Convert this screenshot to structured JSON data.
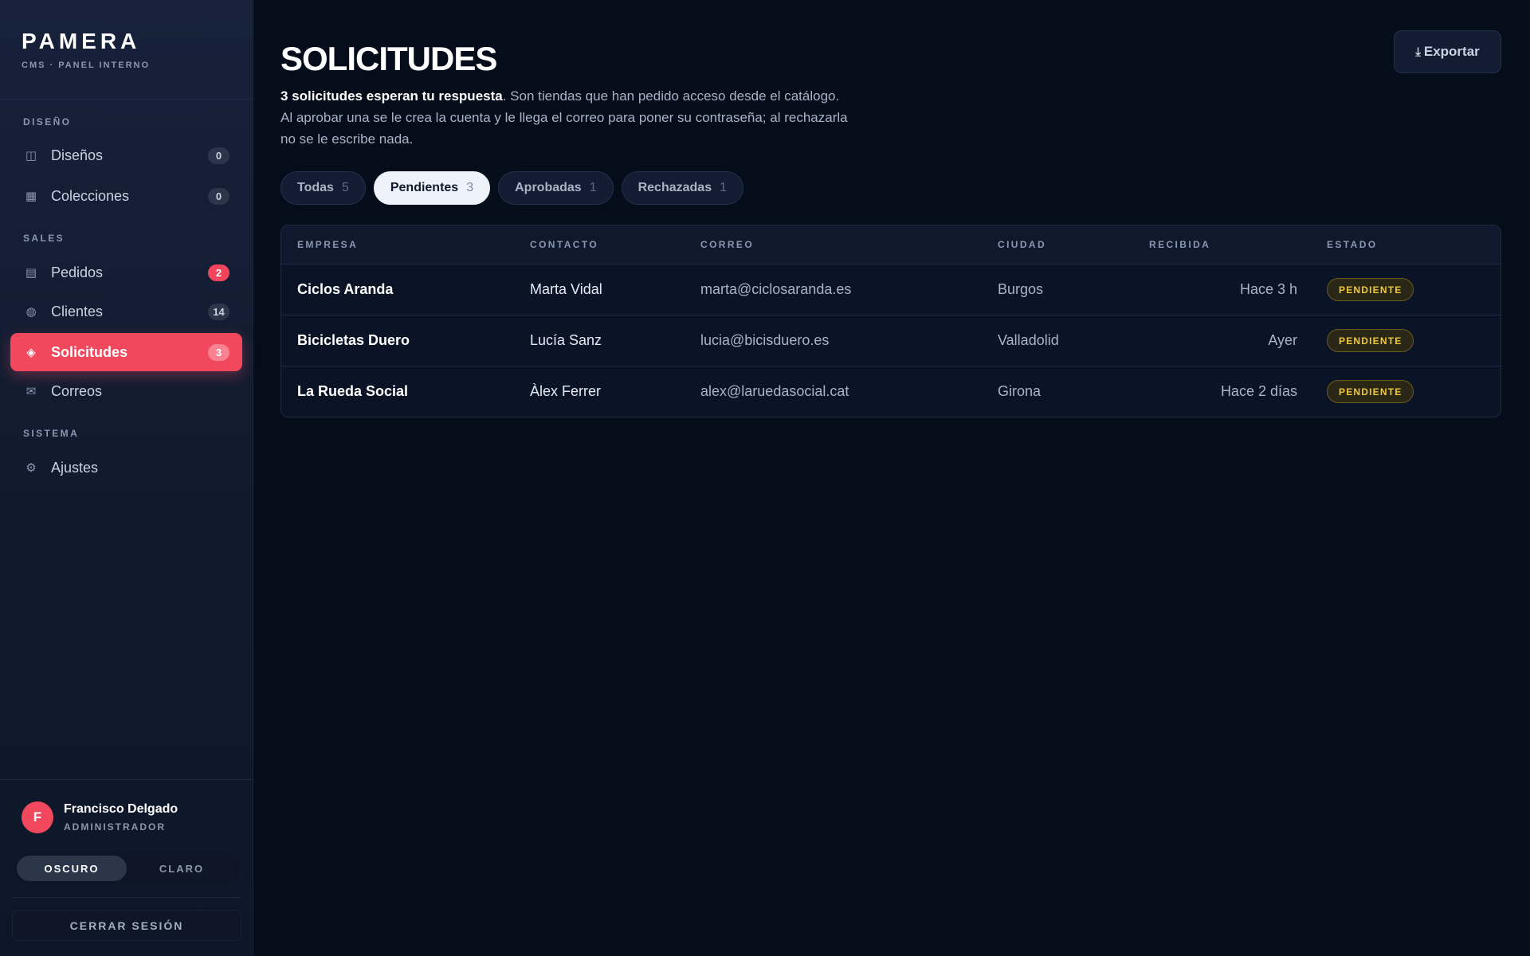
{
  "brand": {
    "name": "PAMERA",
    "subtitle": "CMS · PANEL INTERNO"
  },
  "sidebar": {
    "sections": [
      {
        "title": "DISEÑO",
        "items": [
          {
            "label": "Diseños",
            "icon": "layout-icon",
            "glyph": "◫",
            "badge": "0"
          },
          {
            "label": "Colecciones",
            "icon": "grid-icon",
            "glyph": "▦",
            "badge": "0"
          }
        ]
      },
      {
        "title": "SALES",
        "items": [
          {
            "label": "Pedidos",
            "icon": "receipt-icon",
            "glyph": "▤",
            "badge": "2"
          },
          {
            "label": "Clientes",
            "icon": "globe-icon",
            "glyph": "◍",
            "badge": "14"
          },
          {
            "label": "Solicitudes",
            "icon": "diamond-icon",
            "glyph": "◈",
            "badge": "3"
          },
          {
            "label": "Correos",
            "icon": "mail-icon",
            "glyph": "✉"
          }
        ]
      },
      {
        "title": "SISTEMA",
        "items": [
          {
            "label": "Ajustes",
            "icon": "gear-icon",
            "glyph": "⚙"
          }
        ]
      }
    ]
  },
  "user": {
    "initial": "F",
    "name": "Francisco Delgado",
    "role": "ADMINISTRADOR"
  },
  "theme": {
    "dark": "OSCURO",
    "light": "CLARO"
  },
  "logout_label": "CERRAR SESIÓN",
  "page": {
    "title": "SOLICITUDES",
    "intro_strong": "3 solicitudes esperan tu respuesta",
    "intro_rest": ". Son tiendas que han pedido acceso desde el catálogo. Al aprobar una se le crea la cuenta y le llega el correo para poner su contraseña; al rechazarla no se le escribe nada.",
    "export_label": "Exportar",
    "export_glyph": "⤓"
  },
  "tabs": [
    {
      "label": "Todas",
      "count": "5"
    },
    {
      "label": "Pendientes",
      "count": "3"
    },
    {
      "label": "Aprobadas",
      "count": "1"
    },
    {
      "label": "Rechazadas",
      "count": "1"
    }
  ],
  "table": {
    "headers": {
      "empresa": "EMPRESA",
      "contacto": "CONTACTO",
      "correo": "CORREO",
      "ciudad": "CIUDAD",
      "recibida": "RECIBIDA",
      "estado": "ESTADO"
    },
    "rows": [
      {
        "empresa": "Ciclos Aranda",
        "contacto": "Marta Vidal",
        "correo": "marta@ciclosaranda.es",
        "ciudad": "Burgos",
        "recibida": "Hace 3 h",
        "estado": "PENDIENTE"
      },
      {
        "empresa": "Bicicletas Duero",
        "contacto": "Lucía Sanz",
        "correo": "lucia@bicisduero.es",
        "ciudad": "Valladolid",
        "recibida": "Ayer",
        "estado": "PENDIENTE"
      },
      {
        "empresa": "La Rueda Social",
        "contacto": "Àlex Ferrer",
        "correo": "alex@laruedasocial.cat",
        "ciudad": "Girona",
        "recibida": "Hace 2 días",
        "estado": "PENDIENTE"
      }
    ]
  },
  "colors": {
    "accent": "#f2485d",
    "background": "#050c1a",
    "sidebar": "#17223a",
    "status_pending": "#f0c838"
  }
}
